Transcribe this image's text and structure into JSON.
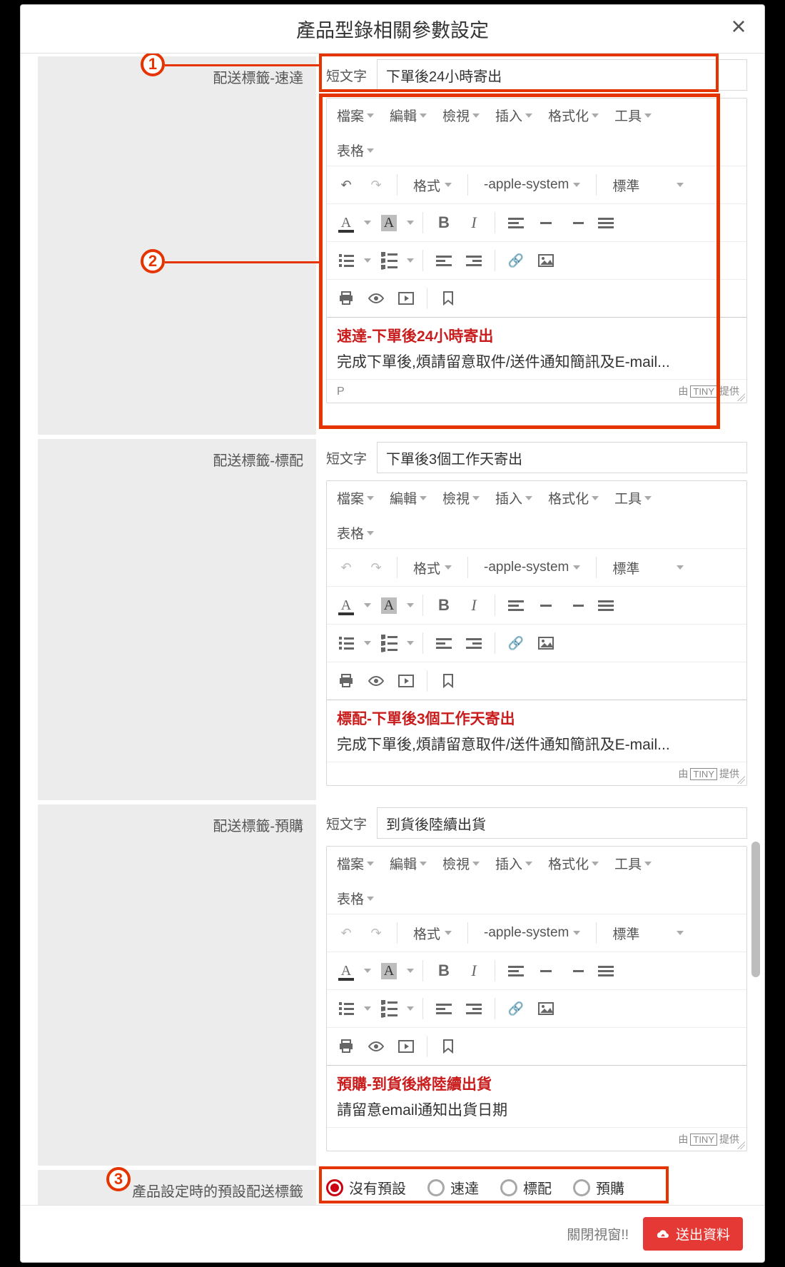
{
  "modal": {
    "title": "產品型錄相關參數設定",
    "close_window_text": "關閉視窗!!",
    "submit_label": "送出資料"
  },
  "callouts": {
    "n1": "1",
    "n2": "2",
    "n3": "3"
  },
  "short_text_label": "短文字",
  "editor": {
    "menu": {
      "file": "檔案",
      "edit": "編輯",
      "view": "檢視",
      "insert": "插入",
      "format": "格式化",
      "tools": "工具",
      "table": "表格"
    },
    "format_select": "格式",
    "font_select": "-apple-system",
    "fontweight_select": "標準",
    "status_p": "P",
    "tiny_by": "由",
    "tiny_name": "TINY",
    "tiny_provided": "提供"
  },
  "sections": [
    {
      "row_label": "配送標籤-速達",
      "short_text": "下單後24小時寄出",
      "content_title": "速達-下單後24小時寄出",
      "content_body": "完成下單後,煩請留意取件/送件通知簡訊及E-mail..."
    },
    {
      "row_label": "配送標籤-標配",
      "short_text": "下單後3個工作天寄出",
      "content_title": "標配-下單後3個工作天寄出",
      "content_body": "完成下單後,煩請留意取件/送件通知簡訊及E-mail..."
    },
    {
      "row_label": "配送標籤-預購",
      "short_text": "到貨後陸續出貨",
      "content_title": "預購-到貨後將陸續出貨",
      "content_body": "請留意email通知出貨日期"
    }
  ],
  "default_label_row": {
    "label": "產品設定時的預設配送標籤",
    "options": [
      "沒有預設",
      "速達",
      "標配",
      "預購"
    ],
    "selected_index": 0
  }
}
